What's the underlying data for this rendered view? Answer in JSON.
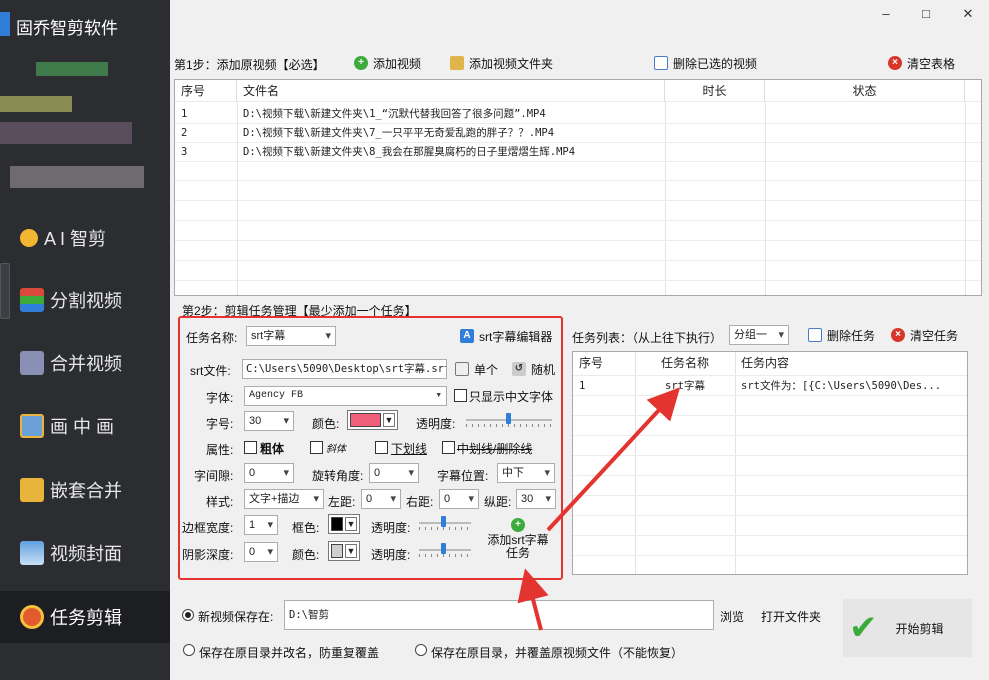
{
  "app": {
    "title": "固乔智剪软件"
  },
  "nav": [
    {
      "label": "A I 智剪",
      "icon": "ai-star-icon",
      "color": "#f2b632"
    },
    {
      "label": "分割视频",
      "icon": "split-video-icon",
      "color": "#d94a3a"
    },
    {
      "label": "合并视频",
      "icon": "merge-video-icon",
      "color": "#8a8fb5"
    },
    {
      "label": "画 中 画",
      "icon": "picture-in-picture-icon",
      "color": "#6b9fd8"
    },
    {
      "label": "嵌套合并",
      "icon": "nest-merge-icon",
      "color": "#e8b43c"
    },
    {
      "label": "视频封面",
      "icon": "video-cover-icon",
      "color": "#5ea0de"
    },
    {
      "label": "任务剪辑",
      "icon": "task-edit-flower-icon",
      "color": "#e25b2e"
    }
  ],
  "step1": {
    "title": "第1步：添加原视频【必选】",
    "add_video": "添加视频",
    "add_folder": "添加视频文件夹",
    "delete_selected": "删除已选的视频",
    "clear_table": "清空表格"
  },
  "video_table": {
    "headers": [
      "序号",
      "文件名",
      "时长",
      "状态"
    ],
    "rows": [
      {
        "no": "1",
        "file": "D:\\视频下载\\新建文件夹\\1_“沉默代替我回答了很多问题”.MP4",
        "duration": "",
        "status": ""
      },
      {
        "no": "2",
        "file": "D:\\视频下载\\新建文件夹\\7_一只平平无奇爱乱跑的胖子？？.MP4",
        "duration": "",
        "status": ""
      },
      {
        "no": "3",
        "file": "D:\\视频下载\\新建文件夹\\8_我会在那腥臭腐朽的日子里熠熠生辉.MP4",
        "duration": "",
        "status": ""
      }
    ]
  },
  "step2": {
    "title": "第2步：剪辑任务管理【最少添加一个任务】"
  },
  "form": {
    "task_name_label": "任务名称:",
    "task_name_value": "srt字幕",
    "srt_editor": "srt字幕编辑器",
    "srt_file_label": "srt文件:",
    "srt_file_value": "C:\\Users\\5090\\Desktop\\srt字幕.srt",
    "single": "单个",
    "random": "随机",
    "font_label": "字体:",
    "font_value": "Agency FB",
    "only_cn_font": "只显示中文字体",
    "size_label": "字号:",
    "size_value": "30",
    "color_label": "颜色:",
    "font_color": "#f0607a",
    "opacity_label": "透明度:",
    "attr_label": "属性:",
    "bold": "粗体",
    "italic": "斜体",
    "underline": "下划线",
    "strike": "中划线/删除线",
    "spacing_label": "字间隙:",
    "spacing_value": "0",
    "rotate_label": "旋转角度:",
    "rotate_value": "0",
    "position_label": "字幕位置:",
    "position_value": "中下",
    "style_label": "样式:",
    "style_value": "文字+描边",
    "left_label": "左距:",
    "left_value": "0",
    "right_label": "右距:",
    "right_value": "0",
    "vert_label": "纵距:",
    "vert_value": "30",
    "border_width_label": "边框宽度:",
    "border_width_value": "1",
    "border_color_label": "框色:",
    "border_color": "#000000",
    "border_opacity_label": "透明度:",
    "shadow_label": "阴影深度:",
    "shadow_value": "0",
    "shadow_color_label": "颜色:",
    "shadow_color": "#cfcfcf",
    "shadow_opacity_label": "透明度:",
    "add_task_line1": "添加srt字幕",
    "add_task_line2": "任务"
  },
  "task_list": {
    "label": "任务列表：（从上往下执行）",
    "group_value": "分组一",
    "delete_task": "删除任务",
    "clear_tasks": "清空任务",
    "headers": [
      "序号",
      "任务名称",
      "任务内容"
    ],
    "rows": [
      {
        "no": "1",
        "name": "srt字幕",
        "content": "srt文件为：[{C:\\Users\\5090\\Des..."
      }
    ]
  },
  "output": {
    "new_save_label": "新视频保存在:",
    "save_path": "D:\\智剪",
    "browse": "浏览",
    "open_folder": "打开文件夹",
    "option_rename": "保存在原目录并改名，防重复覆盖",
    "option_overwrite": "保存在原目录，并覆盖原视频文件（不能恢复）",
    "start": "开始剪辑"
  },
  "colors": {
    "annotation": "#e3342f",
    "accent": "#2f7fd8"
  }
}
